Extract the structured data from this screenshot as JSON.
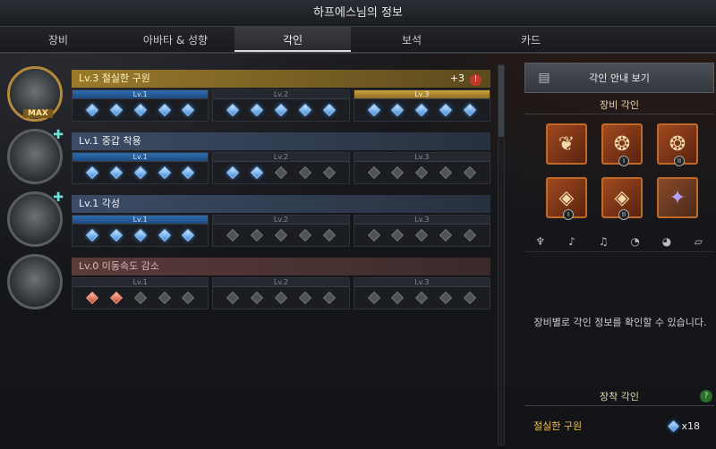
{
  "window": {
    "title": "하프에스님의 정보"
  },
  "tabs": [
    {
      "label": "장비",
      "active": false
    },
    {
      "label": "아바타 & 성향",
      "active": false
    },
    {
      "label": "각인",
      "active": true
    },
    {
      "label": "보석",
      "active": false
    },
    {
      "label": "카드",
      "active": false
    }
  ],
  "engravings": [
    {
      "name": "Lv.3 절실한 구원",
      "bonus": "+3",
      "max": "MAX",
      "style": "gold",
      "levels": [
        {
          "label": "Lv.1"
        },
        {
          "label": "Lv.2"
        },
        {
          "label": "Lv.3"
        }
      ],
      "filled": 15,
      "gemColor": "b"
    },
    {
      "name": "Lv.1 중갑 착용",
      "bonus": "",
      "style": "blue",
      "levels": [
        {
          "label": "Lv.1"
        },
        {
          "label": "Lv.2"
        },
        {
          "label": "Lv.3"
        }
      ],
      "filled": 7,
      "gemColor": "b"
    },
    {
      "name": "Lv.1 각성",
      "bonus": "",
      "style": "blue",
      "levels": [
        {
          "label": "Lv.1"
        },
        {
          "label": "Lv.2"
        },
        {
          "label": "Lv.3"
        }
      ],
      "filled": 5,
      "gemColor": "b"
    },
    {
      "name": "Lv.0 이동속도 감소",
      "bonus": "",
      "style": "red",
      "levels": [
        {
          "label": "Lv.1"
        },
        {
          "label": "Lv.2"
        },
        {
          "label": "Lv.3"
        }
      ],
      "filled": 2,
      "gemColor": "r"
    }
  ],
  "right": {
    "guide_button": "각인 안내 보기",
    "equip_engraving_title": "장비 각인",
    "slot_marks": [
      "I",
      "II",
      "I",
      "II"
    ],
    "info_text": "장비별로 각인 정보를 확인할 수 있습니다.",
    "equipped_title": "장착 각인",
    "help": "?",
    "equipped": {
      "name": "절실한 구원",
      "count": "x18"
    }
  }
}
